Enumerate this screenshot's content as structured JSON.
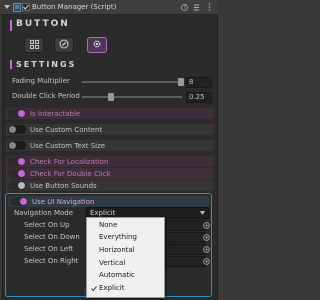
{
  "header": {
    "title": "Button Manager (Script)",
    "icons": [
      "collapse-arrow-icon",
      "script-icon",
      "enabled-checkbox-icon",
      "help-icon",
      "preset-icon",
      "menu-icon"
    ]
  },
  "brand": {
    "title": "BUTTON",
    "accent_color": "#c86bd9",
    "buttons": [
      {
        "name": "tile-grid-icon",
        "active": false
      },
      {
        "name": "compass-icon",
        "active": false
      },
      {
        "name": "gear-icon",
        "active": true
      }
    ]
  },
  "settings": {
    "section_title": "SETTINGS",
    "fading_multiplier": {
      "label": "Fading Multiplier",
      "value": "8"
    },
    "double_click_period": {
      "label": "Double Click Period",
      "value": "0.25"
    },
    "toggles": [
      {
        "label": "Is Interactable",
        "on": true,
        "pink": true
      },
      {
        "label": "Use Custom Content",
        "on": false,
        "pink": false
      },
      {
        "label": "Use Custom Text Size",
        "on": false,
        "pink": false
      },
      {
        "label": "Check For Localization",
        "on": true,
        "pink": true
      },
      {
        "label": "Check For Double Click",
        "on": true,
        "pink": true
      },
      {
        "label": "Use Button Sounds",
        "on": true,
        "pink": false
      }
    ]
  },
  "navigation": {
    "toggle_label": "Use UI Navigation",
    "toggle_on": true,
    "mode_label": "Navigation Mode",
    "mode_value": "Explicit",
    "selectors": [
      {
        "label": "Select On Up"
      },
      {
        "label": "Select On Down"
      },
      {
        "label": "Select On Left"
      },
      {
        "label": "Select On Right"
      }
    ],
    "accent_color": "#2e8fc7"
  },
  "popup": {
    "options": [
      "None",
      "Everything",
      "Horizontal",
      "Vertical",
      "Automatic",
      "Explicit"
    ],
    "selected": "Explicit"
  }
}
